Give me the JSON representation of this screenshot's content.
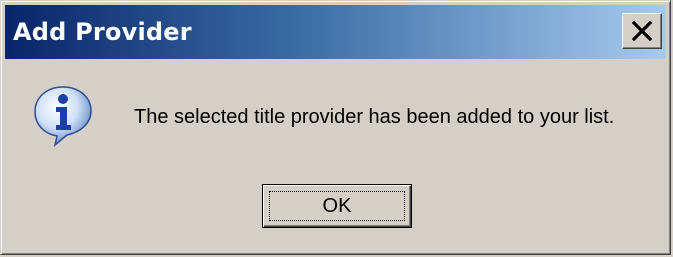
{
  "window": {
    "title": "Add Provider"
  },
  "titlebar": {
    "close_icon": "close-icon"
  },
  "dialog": {
    "icon": "information-icon",
    "message": "The selected title provider has been added to your list.",
    "ok_label": "OK"
  },
  "colors": {
    "titlebar_start": "#0a246a",
    "titlebar_end": "#a6caf0",
    "face": "#d4d0c8"
  }
}
